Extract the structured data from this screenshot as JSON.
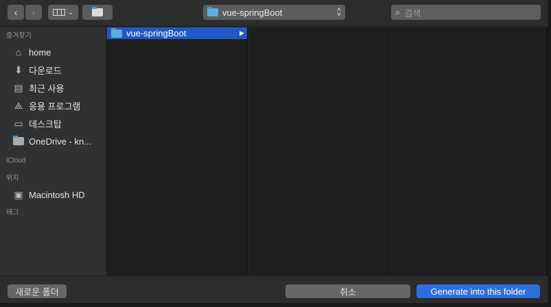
{
  "toolbar": {
    "back": "‹",
    "forward": "›",
    "location": "vue-springBoot",
    "search_placeholder": "검색"
  },
  "sidebar": {
    "favorites_header": "즐겨찾기",
    "favorites": [
      {
        "label": "home",
        "icon": "house-icon"
      },
      {
        "label": "다운로드",
        "icon": "download-icon"
      },
      {
        "label": "최근 사용",
        "icon": "recent-icon"
      },
      {
        "label": "응용 프로그램",
        "icon": "applications-icon"
      },
      {
        "label": "데스크탑",
        "icon": "desktop-icon"
      },
      {
        "label": "OneDrive - kn...",
        "icon": "folder-icon"
      }
    ],
    "icloud_header": "iCloud",
    "locations_header": "위치",
    "locations": [
      {
        "label": "Macintosh HD",
        "icon": "disk-icon"
      }
    ],
    "tags_header": "태그"
  },
  "browser": {
    "selected": "vue-springBoot"
  },
  "footer": {
    "new_folder": "새로운 폴더",
    "cancel": "취소",
    "confirm": "Generate into this folder"
  },
  "colors": {
    "accent": "#2058c8"
  }
}
